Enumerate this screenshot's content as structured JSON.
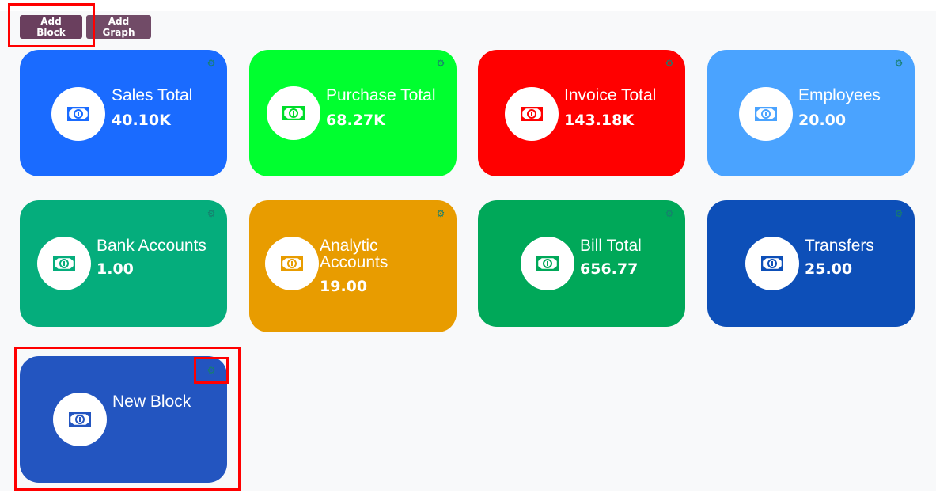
{
  "toolbar": {
    "add_block_label": "Add Block",
    "add_graph_label": "Add Graph"
  },
  "cards": [
    {
      "title": "Sales Total",
      "value": "40.10K",
      "color": "#1a6bff",
      "icon": "money-bill-icon",
      "icon_color": "#1a6bff"
    },
    {
      "title": "Purchase Total",
      "value": "68.27K",
      "color": "#00ff2f",
      "icon": "money-bill-icon",
      "icon_color": "#00dd2a"
    },
    {
      "title": "Invoice Total",
      "value": "143.18K",
      "color": "#ff0000",
      "icon": "money-bill-icon",
      "icon_color": "#ff0000"
    },
    {
      "title": "Employees",
      "value": "20.00",
      "color": "#4aa3ff",
      "icon": "money-bill-icon",
      "icon_color": "#4aa3ff"
    },
    {
      "title": "Bank Accounts",
      "value": "1.00",
      "color": "#05ad7c",
      "icon": "money-bill-icon",
      "icon_color": "#05ad7c"
    },
    {
      "title": "Analytic Accounts",
      "value": "19.00",
      "color": "#e89c00",
      "icon": "money-bill-icon",
      "icon_color": "#e89c00"
    },
    {
      "title": "Bill Total",
      "value": "656.77",
      "color": "#00a859",
      "icon": "money-bill-icon",
      "icon_color": "#00a859"
    },
    {
      "title": "Transfers",
      "value": "25.00",
      "color": "#0d4fb8",
      "icon": "money-bill-icon",
      "icon_color": "#0d4fb8"
    },
    {
      "title": "New Block",
      "value": "",
      "color": "#2355c0",
      "icon": "money-bill-icon",
      "icon_color": "#2355c0"
    }
  ],
  "highlight_color": "#ff0000"
}
